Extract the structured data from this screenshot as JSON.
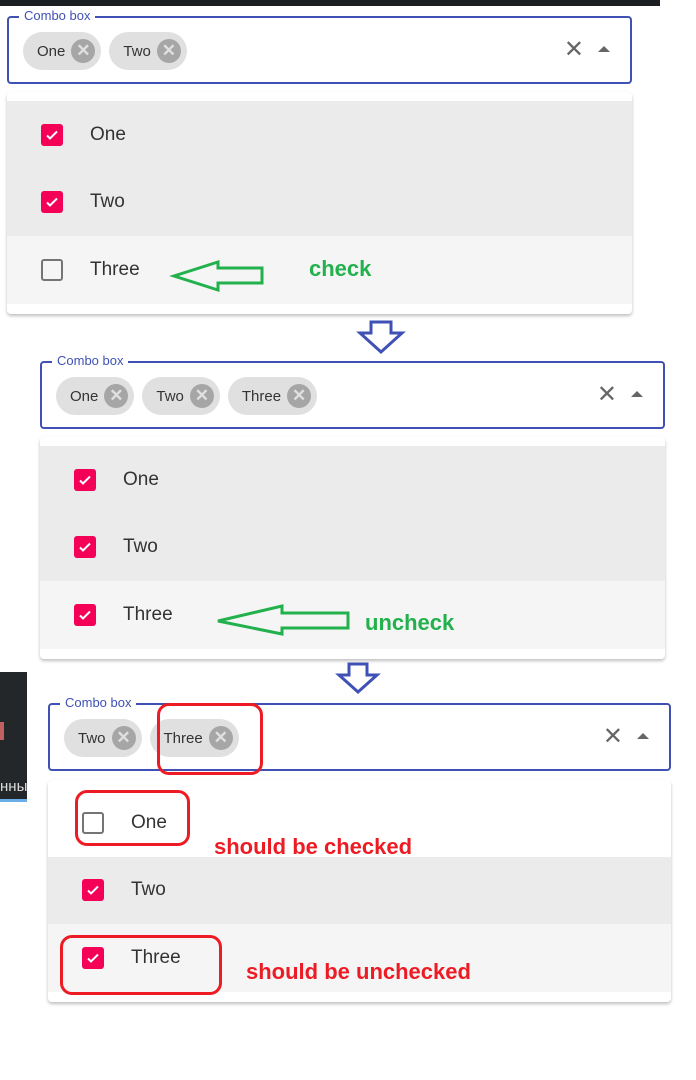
{
  "colors": {
    "accent": "#3f51b5",
    "checkbox": "#f50057",
    "annotation_green": "#22b14c",
    "annotation_red": "#ed1c24"
  },
  "panels": [
    {
      "label": "Combo box",
      "chips": [
        "One",
        "Two"
      ],
      "options": [
        {
          "label": "One",
          "checked": true,
          "state": "selected"
        },
        {
          "label": "Two",
          "checked": true,
          "state": "selected"
        },
        {
          "label": "Three",
          "checked": false,
          "state": "focused"
        }
      ]
    },
    {
      "label": "Combo box",
      "chips": [
        "One",
        "Two",
        "Three"
      ],
      "options": [
        {
          "label": "One",
          "checked": true,
          "state": "selected"
        },
        {
          "label": "Two",
          "checked": true,
          "state": "selected"
        },
        {
          "label": "Three",
          "checked": true,
          "state": "focused"
        }
      ]
    },
    {
      "label": "Combo box",
      "chips": [
        "Two",
        "Three"
      ],
      "options": [
        {
          "label": "One",
          "checked": false,
          "state": "none"
        },
        {
          "label": "Two",
          "checked": true,
          "state": "selected"
        },
        {
          "label": "Three",
          "checked": true,
          "state": "focused"
        }
      ]
    }
  ],
  "annotations": {
    "check": "check",
    "uncheck": "uncheck",
    "should_be_checked": "should be checked",
    "should_be_unchecked": "should be unchecked"
  },
  "background": {
    "sidebar_text": "нны"
  }
}
